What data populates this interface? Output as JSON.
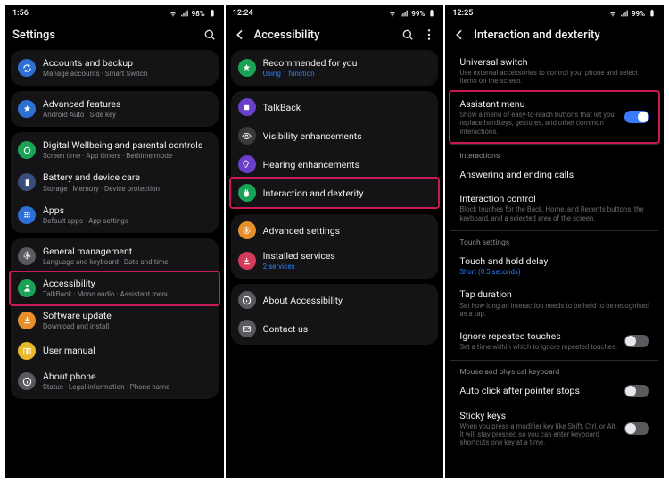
{
  "screens": [
    {
      "status": {
        "time": "1:56",
        "battery": "98%"
      },
      "header": {
        "title": "Settings"
      },
      "groups": [
        {
          "items": [
            {
              "iconColor": "#2e6fd6",
              "icon": "sync",
              "label": "Accounts and backup",
              "sub": "Manage accounts · Smart Switch"
            }
          ]
        },
        {
          "items": [
            {
              "iconColor": "#2e6fd6",
              "icon": "star",
              "label": "Advanced features",
              "sub": "Android Auto · Side key"
            }
          ]
        },
        {
          "items": [
            {
              "iconColor": "#1aa357",
              "icon": "circle",
              "label": "Digital Wellbeing and parental controls",
              "sub": "Screen time · App timers · Bedtime mode"
            },
            {
              "iconColor": "#3a4c7a",
              "icon": "battery",
              "label": "Battery and device care",
              "sub": "Storage · Memory · Device protection"
            },
            {
              "iconColor": "#2e6fd6",
              "icon": "grid",
              "label": "Apps",
              "sub": "Default apps · App settings"
            }
          ]
        },
        {
          "items": [
            {
              "iconColor": "#5a5a5e",
              "icon": "gear",
              "label": "General management",
              "sub": "Language and keyboard · Date and time"
            },
            {
              "iconColor": "#1aa357",
              "icon": "person",
              "label": "Accessibility",
              "sub": "TalkBack · Mono audio · Assistant menu",
              "highlight": true
            },
            {
              "iconColor": "#e98f2a",
              "icon": "download",
              "label": "Software update",
              "sub": "Download and install"
            },
            {
              "iconColor": "#e9b82a",
              "icon": "book",
              "label": "User manual",
              "sub": ""
            },
            {
              "iconColor": "#5a5a5e",
              "icon": "info",
              "label": "About phone",
              "sub": "Status · Legal information · Phone name"
            }
          ]
        }
      ]
    },
    {
      "status": {
        "time": "12:24",
        "battery": "99%"
      },
      "header": {
        "title": "Accessibility",
        "back": true,
        "more": true,
        "search": true
      },
      "groups": [
        {
          "items": [
            {
              "iconColor": "#1aa357",
              "icon": "star",
              "label": "Recommended for you",
              "sub": "Using 1 function",
              "subAccent": true
            }
          ]
        },
        {
          "items": [
            {
              "iconColor": "#6a3fc9",
              "icon": "talk",
              "label": "TalkBack"
            },
            {
              "iconColor": "#3a3a3a",
              "icon": "eye",
              "label": "Visibility enhancements"
            },
            {
              "iconColor": "#6a3fc9",
              "icon": "ear",
              "label": "Hearing enhancements"
            },
            {
              "iconColor": "#1aa357",
              "icon": "hand",
              "label": "Interaction and dexterity",
              "highlight": true
            }
          ]
        },
        {
          "items": [
            {
              "iconColor": "#e98f2a",
              "icon": "gear",
              "label": "Advanced settings"
            },
            {
              "iconColor": "#d63a5a",
              "icon": "download",
              "label": "Installed services",
              "sub": "2 services",
              "subAccent": true
            }
          ]
        },
        {
          "items": [
            {
              "iconColor": "#5a5a5e",
              "icon": "info",
              "label": "About Accessibility"
            },
            {
              "iconColor": "#5a5a5e",
              "icon": "mail",
              "label": "Contact us"
            }
          ]
        }
      ]
    },
    {
      "status": {
        "time": "12:25",
        "battery": "99%"
      },
      "header": {
        "title": "Interaction and dexterity",
        "back": true
      },
      "sections": [
        {
          "items": [
            {
              "label": "Universal switch",
              "sub": "Use external accessories to control your phone and select items on the screen."
            },
            {
              "label": "Assistant menu",
              "sub": "Show a menu of easy-to-reach buttons that let you replace hardkeys, gestures, and other common interactions.",
              "toggle": true,
              "on": true,
              "highlight": true
            }
          ]
        },
        {
          "title": "Interactions",
          "items": [
            {
              "label": "Answering and ending calls"
            },
            {
              "label": "Interaction control",
              "sub": "Block touches for the Back, Home, and Recents buttons, the keyboard, and a selected area of the screen."
            }
          ]
        },
        {
          "title": "Touch settings",
          "items": [
            {
              "label": "Touch and hold delay",
              "sub": "Short (0.5 seconds)",
              "subAccent": true
            },
            {
              "label": "Tap duration",
              "sub": "Set how long an interaction needs to be held to be recognised as a tap."
            },
            {
              "label": "Ignore repeated touches",
              "sub": "Set a time within which to ignore repeated touches.",
              "toggle": true,
              "on": false
            }
          ]
        },
        {
          "title": "Mouse and physical keyboard",
          "items": [
            {
              "label": "Auto click after pointer stops",
              "toggle": true,
              "on": false
            },
            {
              "label": "Sticky keys",
              "sub": "When you press a modifier key like Shift, Ctrl, or Alt, it will stay pressed so you can enter keyboard shortcuts one key at a time.",
              "toggle": true,
              "on": false
            }
          ]
        }
      ]
    }
  ]
}
